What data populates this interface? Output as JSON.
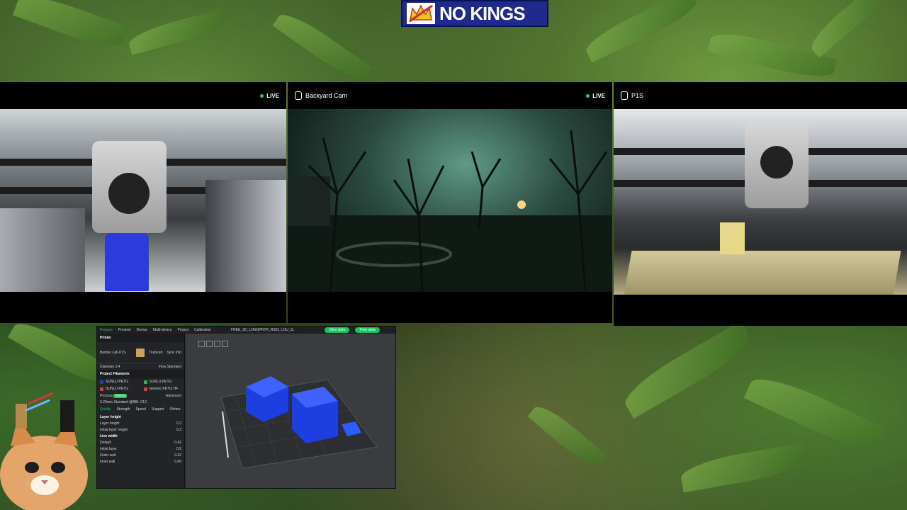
{
  "banner": {
    "title": "NO KINGS"
  },
  "cams": [
    {
      "name": "",
      "live": "LIVE"
    },
    {
      "name": "Backyard Cam",
      "live": "LIVE"
    },
    {
      "name": "P1S",
      "live": ""
    }
  ],
  "slicer": {
    "menubar": {
      "tabs": [
        "Prepare",
        "Preview",
        "Device",
        "Multi-device",
        "Project",
        "Calibration"
      ],
      "active": "Prepare",
      "window_title": "FREE_3D_LONGPRTR_R003_LOU_1L",
      "slice_label": "Slice plate",
      "print_label": "Print plate"
    },
    "printer": {
      "section": "Printer",
      "model": "Bambu Lab P1S",
      "plate": "Textured",
      "sync": "Sync info",
      "diameter_label": "Diameter",
      "diameter_value": "0.4",
      "flow_label": "Flow",
      "flow_value": "Standard"
    },
    "filaments": {
      "section": "Project Filaments",
      "items": [
        {
          "num": "1",
          "name": "SUNLU PETG",
          "color": "#1e3fd6"
        },
        {
          "num": "2",
          "name": "SUNLU PETG",
          "color": "#19c35a"
        },
        {
          "num": "3",
          "name": "SUNLU PETG",
          "color": "#e23b3b"
        },
        {
          "num": "4",
          "name": "Generic PETG HF",
          "color": "#e23b3b"
        }
      ]
    },
    "process": {
      "label": "Process",
      "toggle": "Global",
      "advanced": "Advanced",
      "preset": "0.20mm Standard @BBL X1C",
      "tabs": [
        "Quality",
        "Strength",
        "Speed",
        "Support",
        "Others"
      ],
      "layer_section": "Layer height",
      "layer_rows": [
        {
          "label": "Layer height",
          "value": "0.2"
        },
        {
          "label": "Initial layer height",
          "value": "0.2"
        }
      ],
      "width_section": "Line width",
      "width_rows": [
        {
          "label": "Default",
          "value": "0.42"
        },
        {
          "label": "Initial layer",
          "value": "0.5"
        },
        {
          "label": "Outer wall",
          "value": "0.42"
        },
        {
          "label": "Inner wall",
          "value": "0.45"
        }
      ]
    }
  }
}
